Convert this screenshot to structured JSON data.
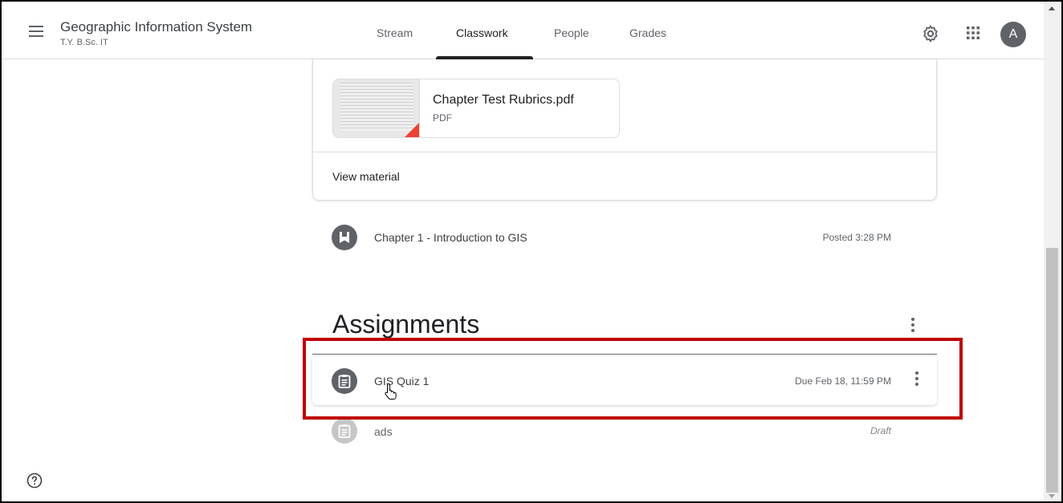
{
  "header": {
    "class_title": "Geographic Information System",
    "class_subtitle": "T.Y. B.Sc. IT",
    "tabs": [
      {
        "label": "Stream",
        "active": false
      },
      {
        "label": "Classwork",
        "active": true
      },
      {
        "label": "People",
        "active": false
      },
      {
        "label": "Grades",
        "active": false
      }
    ],
    "avatar_initial": "A",
    "icons": [
      "menu-icon",
      "gear-icon",
      "apps-grid-icon"
    ]
  },
  "material": {
    "attachment_name": "Chapter Test Rubrics.pdf",
    "attachment_type": "PDF",
    "view_label": "View material"
  },
  "topic_item": {
    "title": "Chapter 1 - Introduction to GIS",
    "meta": "Posted 3:28 PM",
    "icon": "bookmark-icon"
  },
  "assignments": {
    "section_title": "Assignments",
    "items": [
      {
        "title": "GIS Quiz 1",
        "meta": "Due Feb 18, 11:59 PM",
        "icon": "assignment-icon"
      },
      {
        "title": "ads",
        "meta": "Draft",
        "icon": "assignment-icon"
      }
    ]
  },
  "colors": {
    "highlight": "#c00000",
    "icon_circle": "#5f6368",
    "draft_icon_circle": "#c6c6c6",
    "pdf_corner": "#ea4335"
  }
}
